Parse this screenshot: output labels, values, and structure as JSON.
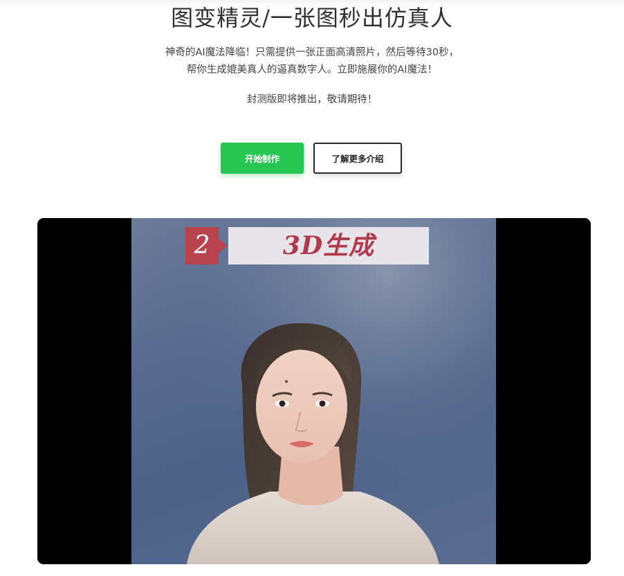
{
  "hero": {
    "title": "图变精灵/一张图秒出仿真人",
    "description": "神奇的AI魔法降临！只需提供一张正面高清照片，然后等待30秒，帮你生成媲美真人的逼真数字人。立即施展你的AI魔法！",
    "notice": "封测版即将推出，敬请期待！"
  },
  "buttons": {
    "start_label": "开始制作",
    "learn_more_label": "了解更多介绍"
  },
  "video": {
    "caption_number": "2",
    "caption_text": "3D生成"
  },
  "colors": {
    "primary_green": "#27c653",
    "caption_red": "#b8434e",
    "video_background": "#000000"
  }
}
